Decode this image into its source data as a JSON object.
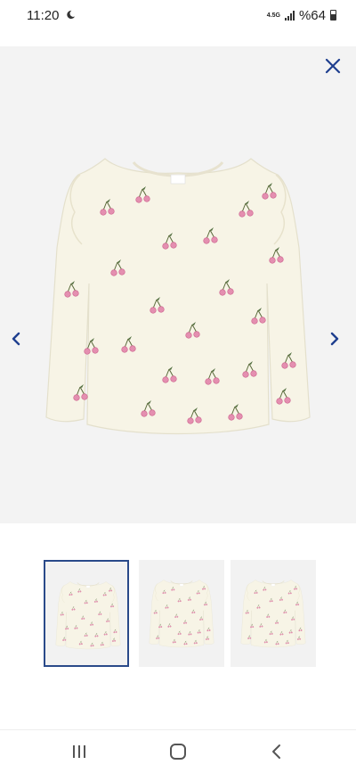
{
  "status_bar": {
    "time": "11:20",
    "network_label": "4.5G",
    "battery_text": "%64",
    "moon_icon": "moon-icon",
    "battery_level": 0.64
  },
  "viewer": {
    "close_icon": "close-icon",
    "prev_icon": "chevron-left-icon",
    "next_icon": "chevron-right-icon",
    "accent_color": "#1f3f8f",
    "background_color": "#f3f3f3"
  },
  "thumbnails": {
    "count": 3,
    "active_index": 0,
    "active_border_color": "#2a4a8a"
  },
  "system_nav": {
    "recents_icon": "recents-icon",
    "home_icon": "home-icon",
    "back_icon": "back-icon"
  }
}
